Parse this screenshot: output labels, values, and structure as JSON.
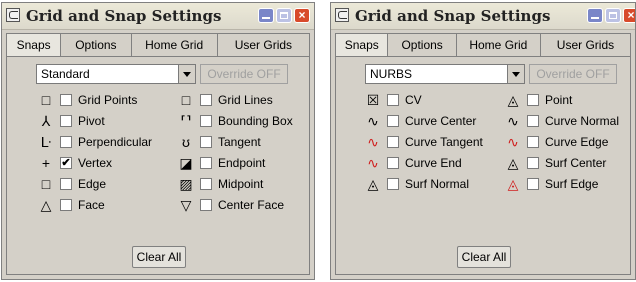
{
  "windows": [
    {
      "title": "Grid and Snap Settings",
      "tabs": [
        "Snaps",
        "Options",
        "Home Grid",
        "User Grids"
      ],
      "active_tab": "Snaps",
      "dropdown_value": "Standard",
      "override_label": "Override OFF",
      "left_items": [
        {
          "icon": "□",
          "label": "Grid Points",
          "checked": false
        },
        {
          "icon": "⅄",
          "label": "Pivot",
          "checked": false
        },
        {
          "icon": "ᒷ",
          "label": "Perpendicular",
          "checked": false
        },
        {
          "icon": "+",
          "label": "Vertex",
          "checked": true
        },
        {
          "icon": "□",
          "label": "Edge",
          "checked": false
        },
        {
          "icon": "△",
          "label": "Face",
          "checked": false
        }
      ],
      "right_items": [
        {
          "icon": "□",
          "label": "Grid Lines",
          "checked": false
        },
        {
          "icon": "⸢⸣",
          "label": "Bounding Box",
          "checked": false
        },
        {
          "icon": "ʊ",
          "label": "Tangent",
          "checked": false
        },
        {
          "icon": "◪",
          "label": "Endpoint",
          "checked": false
        },
        {
          "icon": "▨",
          "label": "Midpoint",
          "checked": false
        },
        {
          "icon": "▽",
          "label": "Center Face",
          "checked": false
        }
      ],
      "clear_label": "Clear All"
    },
    {
      "title": "Grid and Snap Settings",
      "tabs": [
        "Snaps",
        "Options",
        "Home Grid",
        "User Grids"
      ],
      "active_tab": "Snaps",
      "dropdown_value": "NURBS",
      "override_label": "Override OFF",
      "left_items": [
        {
          "icon": "☒",
          "label": "CV",
          "checked": false
        },
        {
          "icon": "∿",
          "label": "Curve Center",
          "checked": false
        },
        {
          "icon": "∿",
          "label": "Curve Tangent",
          "checked": false
        },
        {
          "icon": "∿",
          "label": "Curve End",
          "checked": false
        },
        {
          "icon": "◬",
          "label": "Surf Normal",
          "checked": false
        }
      ],
      "right_items": [
        {
          "icon": "◬",
          "label": "Point",
          "checked": false
        },
        {
          "icon": "∿",
          "label": "Curve Normal",
          "checked": false
        },
        {
          "icon": "∿",
          "label": "Curve Edge",
          "checked": false
        },
        {
          "icon": "◬",
          "label": "Surf Center",
          "checked": false
        },
        {
          "icon": "◬",
          "label": "Surf Edge",
          "checked": false
        }
      ],
      "clear_label": "Clear All"
    }
  ]
}
